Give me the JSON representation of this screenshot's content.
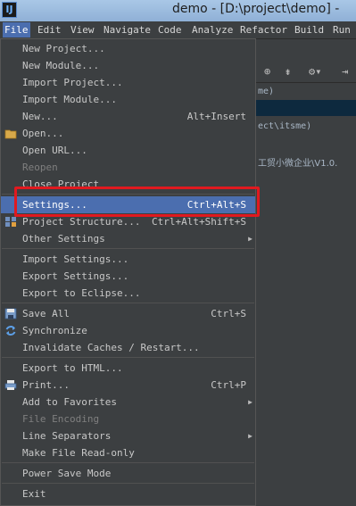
{
  "window": {
    "title": "demo - [D:\\project\\demo] -",
    "app_icon_glyph": "IJ"
  },
  "menubar": {
    "items": [
      "File",
      "Edit",
      "View",
      "Navigate",
      "Code",
      "Analyze",
      "Refactor",
      "Build",
      "Run"
    ],
    "active": "File"
  },
  "background": {
    "tree_lines": [
      "me)",
      "ect\\itsme)",
      "工贸小微企业\\V1.0."
    ]
  },
  "file_menu": {
    "items": [
      {
        "label": "New Project...",
        "shortcut": ""
      },
      {
        "label": "New Module...",
        "shortcut": ""
      },
      {
        "label": "Import Project...",
        "shortcut": ""
      },
      {
        "label": "Import Module...",
        "shortcut": ""
      },
      {
        "label": "New...",
        "shortcut": "Alt+Insert"
      },
      {
        "label": "Open...",
        "shortcut": ""
      },
      {
        "label": "Open URL...",
        "shortcut": ""
      },
      {
        "label": "Reopen",
        "shortcut": ""
      },
      {
        "label": "Close Project",
        "shortcut": ""
      },
      {
        "label": "Settings...",
        "shortcut": "Ctrl+Alt+S"
      },
      {
        "label": "Project Structure...",
        "shortcut": "Ctrl+Alt+Shift+S"
      },
      {
        "label": "Other Settings",
        "shortcut": ""
      },
      {
        "label": "Import Settings...",
        "shortcut": ""
      },
      {
        "label": "Export Settings...",
        "shortcut": ""
      },
      {
        "label": "Export to Eclipse...",
        "shortcut": ""
      },
      {
        "label": "Save All",
        "shortcut": "Ctrl+S"
      },
      {
        "label": "Synchronize",
        "shortcut": ""
      },
      {
        "label": "Invalidate Caches / Restart...",
        "shortcut": ""
      },
      {
        "label": "Export to HTML...",
        "shortcut": ""
      },
      {
        "label": "Print...",
        "shortcut": "Ctrl+P"
      },
      {
        "label": "Add to Favorites",
        "shortcut": ""
      },
      {
        "label": "File Encoding",
        "shortcut": ""
      },
      {
        "label": "Line Separators",
        "shortcut": ""
      },
      {
        "label": "Make File Read-only",
        "shortcut": ""
      },
      {
        "label": "Power Save Mode",
        "shortcut": ""
      },
      {
        "label": "Exit",
        "shortcut": ""
      }
    ]
  },
  "icons": {
    "open": "folder-icon",
    "project_structure": "project-structure-icon",
    "save_all": "save-icon",
    "synchronize": "sync-icon",
    "print": "printer-icon",
    "toolbar": [
      "target-icon",
      "collapse-icon",
      "gear-icon",
      "hide-icon"
    ]
  },
  "colors": {
    "highlight": "#4b6eaf",
    "annotation_box": "#e0191f"
  }
}
